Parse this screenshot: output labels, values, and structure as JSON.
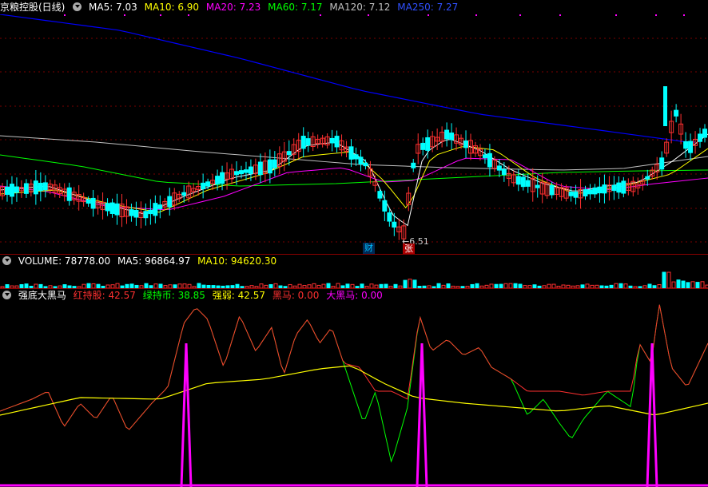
{
  "main_panel": {
    "title": "京粮控股(日线)",
    "indicators": [
      {
        "label": "MA5: 7.03",
        "color": "#ffffff"
      },
      {
        "label": "MA10: 6.90",
        "color": "#ffff00"
      },
      {
        "label": "MA20: 7.23",
        "color": "#ff00ff"
      },
      {
        "label": "MA60: 7.17",
        "color": "#00ff00"
      },
      {
        "label": "MA120: 7.12",
        "color": "#c0c0c0"
      },
      {
        "label": "MA250: 7.27",
        "color": "#0000ff"
      }
    ],
    "low_annotation": "6.51",
    "markers": [
      {
        "label": "财",
        "color": "#00bfff",
        "bg": "#003366"
      },
      {
        "label": "张",
        "color": "#ffffff",
        "bg": "#aa0000"
      }
    ]
  },
  "volume_panel": {
    "indicators": [
      {
        "label": "VOLUME: 78778.00",
        "color": "#ffffff"
      },
      {
        "label": "MA5: 96864.97",
        "color": "#ffffff"
      },
      {
        "label": "MA10: 94620.30",
        "color": "#ffff00"
      }
    ]
  },
  "indicator_panel": {
    "title": "强底大黑马",
    "indicators": [
      {
        "label": "红持股: 42.57",
        "color": "#ff3030"
      },
      {
        "label": "绿持币: 38.85",
        "color": "#00ff00"
      },
      {
        "label": "强弱: 42.57",
        "color": "#ffff00"
      },
      {
        "label": "黑马: 0.00",
        "color": "#ff3030"
      },
      {
        "label": "大黑马: 0.00",
        "color": "#ff00ff"
      }
    ]
  },
  "colors": {
    "up": "#ff3030",
    "down": "#00ffff",
    "ma250": "#0000ff",
    "ma120": "#c0c0c0",
    "ma60": "#00ff00",
    "ma20": "#ff00ff",
    "ma10": "#ffff00",
    "ma5": "#ffffff"
  }
}
